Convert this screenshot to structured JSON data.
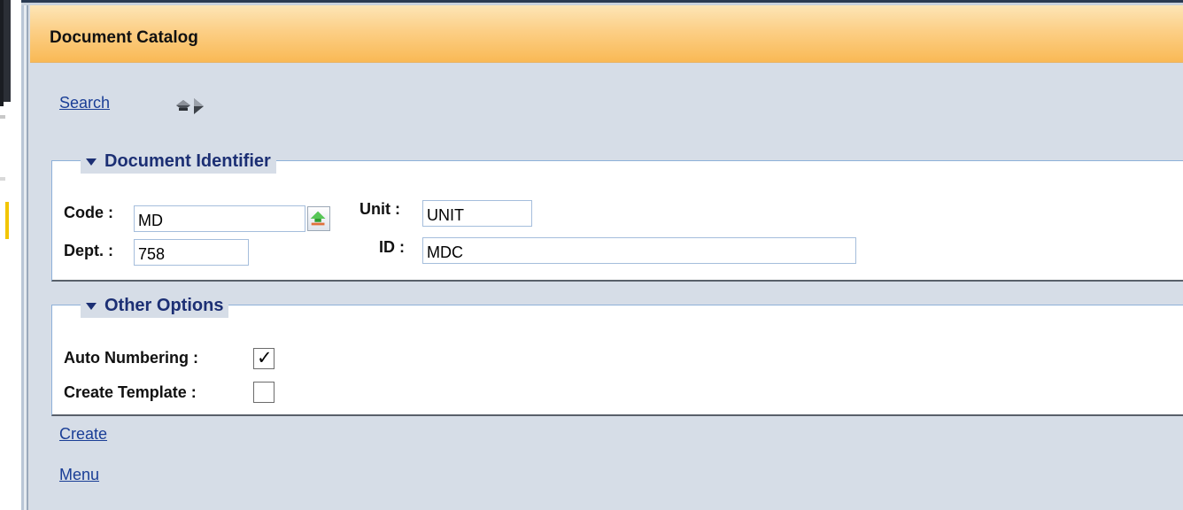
{
  "window": {
    "title": "Document Catalog"
  },
  "toolbar": {
    "search_link": "Search",
    "nav_icon": "prev-next-arrows-icon"
  },
  "document_identifier": {
    "legend": "Document Identifier",
    "code": {
      "label": "Code :",
      "value": "MD"
    },
    "unit": {
      "label": "Unit :",
      "value": "UNIT"
    },
    "dept": {
      "label": "Dept. :",
      "value": "758"
    },
    "id": {
      "label": "ID :",
      "value": "MDC"
    },
    "lookup_icon": "upload-arrow-icon"
  },
  "other_options": {
    "legend": "Other Options",
    "auto_numbering": {
      "label": "Auto Numbering :",
      "checked": true,
      "mark": "✓"
    },
    "create_template": {
      "label": "Create Template :",
      "checked": false,
      "mark": ""
    }
  },
  "actions": {
    "create_link": "Create",
    "menu_link": "Menu"
  },
  "colors": {
    "title_gradient_top": "#fde5b6",
    "title_gradient_bottom": "#f9b955",
    "panel_background": "#d6dde7",
    "legend_color": "#1c2f74",
    "link_color": "#1a3e96",
    "link_secondary_color": "#2a66c8"
  }
}
